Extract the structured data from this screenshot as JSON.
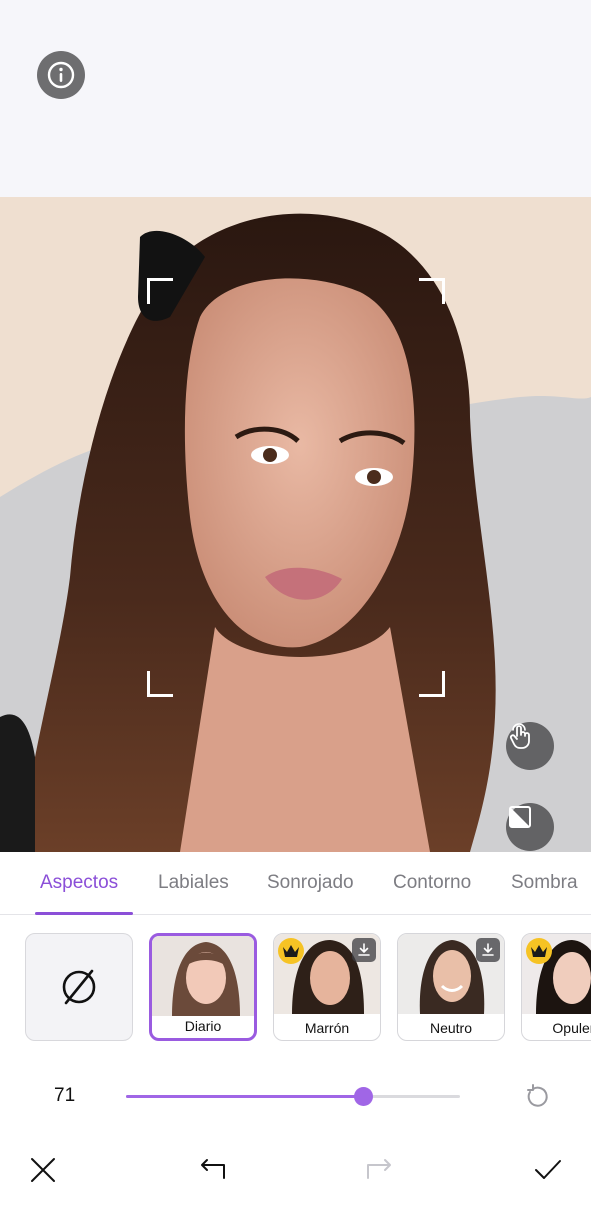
{
  "colors": {
    "accent": "#8b4fd8",
    "inactive_tab": "#7d7d83",
    "crown": "#f6c324"
  },
  "top": {
    "info_icon": "info-icon"
  },
  "photo": {
    "overlay_icons": [
      "touch-icon",
      "compare-icon"
    ]
  },
  "tabs": [
    {
      "label": "Aspectos",
      "active": true
    },
    {
      "label": "Labiales",
      "active": false
    },
    {
      "label": "Sonrojado",
      "active": false
    },
    {
      "label": "Contorno",
      "active": false
    },
    {
      "label": "Sombra",
      "active": false
    }
  ],
  "styles": {
    "none_icon": "none-icon",
    "items": [
      {
        "label": "Diario",
        "selected": true,
        "premium": false,
        "download": false
      },
      {
        "label": "Marrón",
        "selected": false,
        "premium": true,
        "download": true
      },
      {
        "label": "Neutro",
        "selected": false,
        "premium": false,
        "download": true
      },
      {
        "label": "Opulen",
        "selected": false,
        "premium": true,
        "download": false
      }
    ]
  },
  "slider": {
    "value": "71",
    "fraction": 0.71
  },
  "bottom": {
    "icons": [
      "close-icon",
      "undo-icon",
      "redo-icon",
      "check-icon"
    ]
  }
}
